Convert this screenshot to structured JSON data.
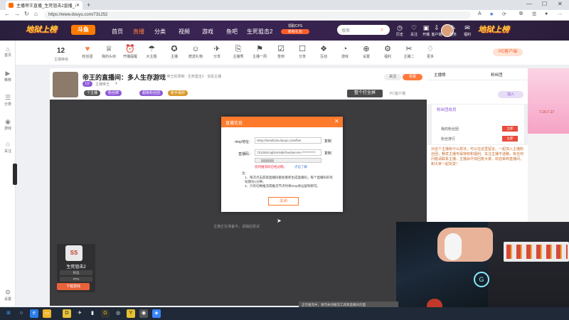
{
  "browser": {
    "tab_title": "主播帝王直播_生死狙击2直播_斗",
    "url": "https://www.douyu.com/731252",
    "new_tab": "+"
  },
  "header": {
    "logo_text": "斗鱼",
    "banner_left": "地狱上榜",
    "banner_right": "地狱上榜",
    "nav": [
      "首页",
      "直播",
      "分类",
      "视频",
      "游戏",
      "鱼吧",
      "生死狙击2"
    ],
    "promo_title": "领取CPS",
    "promo_button": "新秋礼包",
    "search_placeholder": "搜索",
    "icons": [
      {
        "icon": "history-icon",
        "label": "历史"
      },
      {
        "icon": "follow-icon",
        "label": "关注"
      },
      {
        "icon": "live-icon",
        "label": "开播"
      },
      {
        "icon": "download-icon",
        "label": "客户端"
      },
      {
        "icon": "task-icon",
        "label": "任务"
      },
      {
        "icon": "gift-icon",
        "label": "福利"
      }
    ]
  },
  "sidebar": [
    {
      "icon": "home-icon",
      "label": "首页"
    },
    {
      "icon": "play-icon",
      "label": "推荐"
    },
    {
      "icon": "list-icon",
      "label": "分类"
    },
    {
      "icon": "game-icon",
      "label": "游戏"
    },
    {
      "icon": "star-icon",
      "label": "关注"
    },
    {
      "icon": "settings-icon",
      "label": "设置"
    }
  ],
  "toolbar": {
    "level": "12",
    "level_label": "主播等级",
    "items": [
      "粉丝团",
      "我的头衔",
      "开播提醒",
      "大主题",
      "主播",
      "赠送礼物",
      "分享",
      "主播秀",
      "主播一周",
      "签到",
      "分享",
      "互动",
      "游戏",
      "设置",
      "福利",
      "主播二",
      "更多"
    ],
    "pc_button": "PC客户端"
  },
  "room": {
    "title": "帝王的直播间：多人生存游戏",
    "meta": "分区 · 帝王的录制 · 生死狙击2 · 全民主播",
    "streamer": "主播帝王",
    "follower_count": "4",
    "tags": [
      "个主播",
      "粉丝牌",
      "超级粉丝团",
      "新手保护"
    ],
    "follow_label": "关注",
    "report_label": "举报",
    "download_btn": "PC客户端",
    "fullscreen_btn": "整个打全屏"
  },
  "video": {
    "hint": "主播正在准备中，请稍后尝试"
  },
  "dialog": {
    "title": "直播信息",
    "rtmp_label": "rtmp地址：",
    "rtmp_value": "rtmp://sendtc3a.douyu.com/live",
    "key_label": "直播码：",
    "key_value": "731252rUqbSmNbd?wsSecret=***********",
    "copy_label": "复制",
    "warning": "您的推流码已经过期，",
    "warning_link": "点击了解",
    "notes_title": "注：",
    "notes": [
      "1、每次点击获取直播码都会重新生成直播码，每个直播码的有效期为1分钟。",
      "2、只有切换推流或推流节点时将rtmp地址复制即可。"
    ],
    "ok_button": "关闭"
  },
  "right_panel": {
    "tab1": "主播榜",
    "tab2": "粉丝团",
    "fan_label": "粉丝团成员",
    "fan_rows": [
      "我的粉丝团",
      "粉丝排行"
    ],
    "notice": "对这个主播有什么想法，可以在这里留言。一起加入主播粉丝团，畅享主播专属特权和福利。关注主播不迷路，有任何问题请联系主播，主播会尽快回复大家。欢迎来到直播间，和大家一起玩耍！",
    "ad_text": "7.16-7.17"
  },
  "game_card": {
    "name": "生死狙击2",
    "tag1": "射击",
    "tag2": "FPS",
    "download": "下载游戏"
  },
  "toast": "正在推流中，请勿关闭推流工具和直播间页面"
}
